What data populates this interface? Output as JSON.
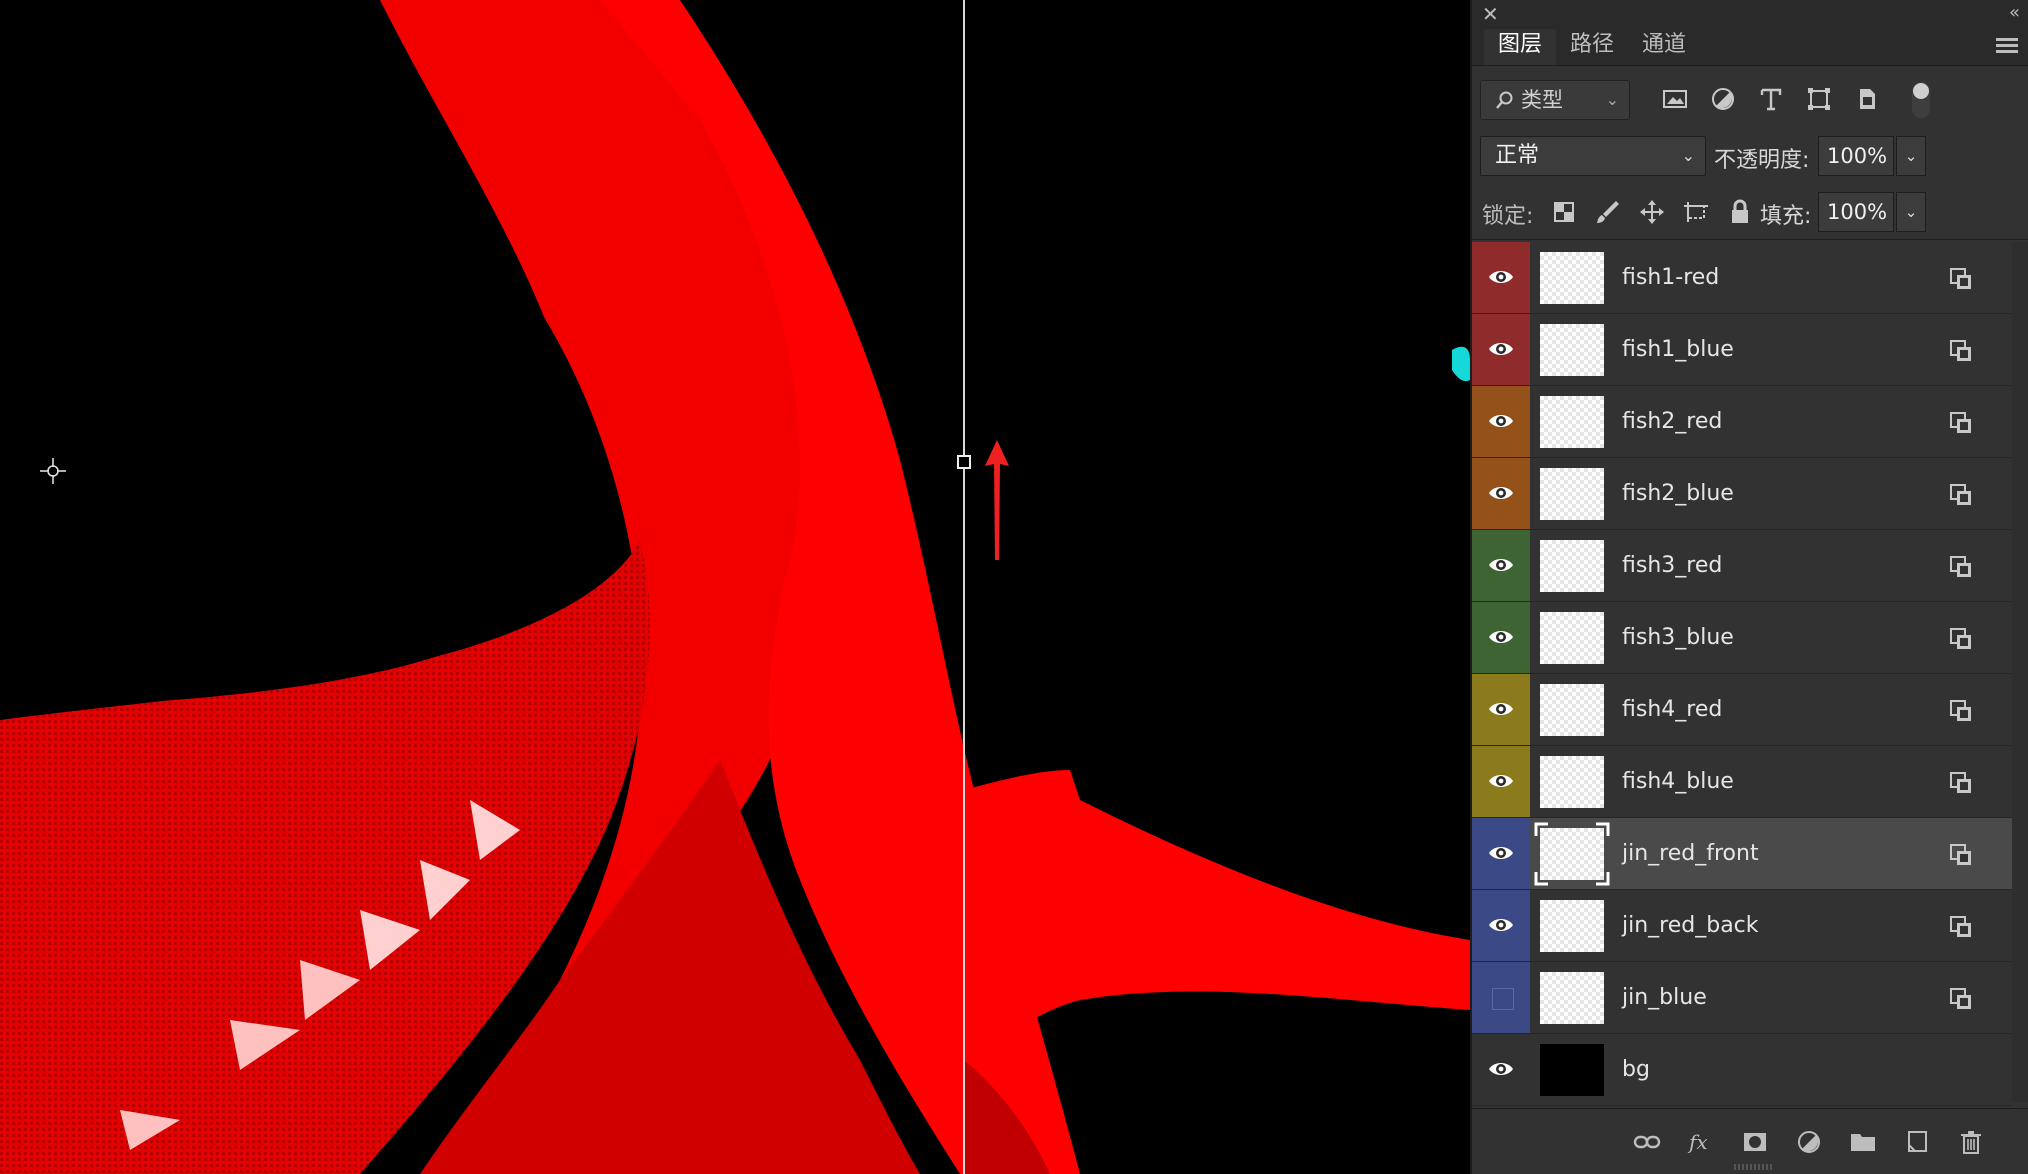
{
  "panel": {
    "close_glyph": "✕",
    "collapse_glyph": "«",
    "tabs": [
      {
        "label": "图层",
        "active": true
      },
      {
        "label": "路径",
        "active": false
      },
      {
        "label": "通道",
        "active": false
      }
    ],
    "filter": {
      "placeholder": "类型",
      "icon": "search-icon"
    },
    "filter_icons": [
      "image-filter-icon",
      "adjustment-filter-icon",
      "type-filter-icon",
      "shape-filter-icon",
      "smart-object-filter-icon"
    ],
    "blend_mode": "正常",
    "opacity_label": "不透明度:",
    "opacity_value": "100%",
    "lock_label": "锁定:",
    "fill_label": "填充:",
    "fill_value": "100%",
    "lock_icons": [
      "lock-transparent-icon",
      "lock-paint-icon",
      "lock-position-icon",
      "lock-artboard-icon",
      "lock-all-icon"
    ],
    "layers": [
      {
        "name": "fish1-red",
        "color": "red",
        "visible": true,
        "selected": false
      },
      {
        "name": "fish1_blue",
        "color": "red",
        "visible": true,
        "selected": false
      },
      {
        "name": "fish2_red",
        "color": "orange",
        "visible": true,
        "selected": false
      },
      {
        "name": "fish2_blue",
        "color": "orange",
        "visible": true,
        "selected": false
      },
      {
        "name": "fish3_red",
        "color": "green",
        "visible": true,
        "selected": false
      },
      {
        "name": "fish3_blue",
        "color": "green",
        "visible": true,
        "selected": false
      },
      {
        "name": "fish4_red",
        "color": "yellow",
        "visible": true,
        "selected": false
      },
      {
        "name": "fish4_blue",
        "color": "yellow",
        "visible": true,
        "selected": false
      },
      {
        "name": "jin_red_front",
        "color": "blue",
        "visible": true,
        "selected": true
      },
      {
        "name": "jin_red_back",
        "color": "blue",
        "visible": true,
        "selected": false
      },
      {
        "name": "jin_blue",
        "color": "blue",
        "visible": false,
        "selected": false
      },
      {
        "name": "bg",
        "color": "none",
        "visible": true,
        "selected": false,
        "thumb": "black"
      }
    ],
    "footer_icons": [
      "link-layers-icon",
      "fx-icon",
      "layer-mask-icon",
      "adjustment-layer-icon",
      "group-folder-icon",
      "new-layer-icon",
      "trash-icon"
    ]
  },
  "colors": {
    "canvas_red": "#ff0000",
    "guide": "#d9d9d9",
    "annotation_arrow": "#ee2020"
  }
}
